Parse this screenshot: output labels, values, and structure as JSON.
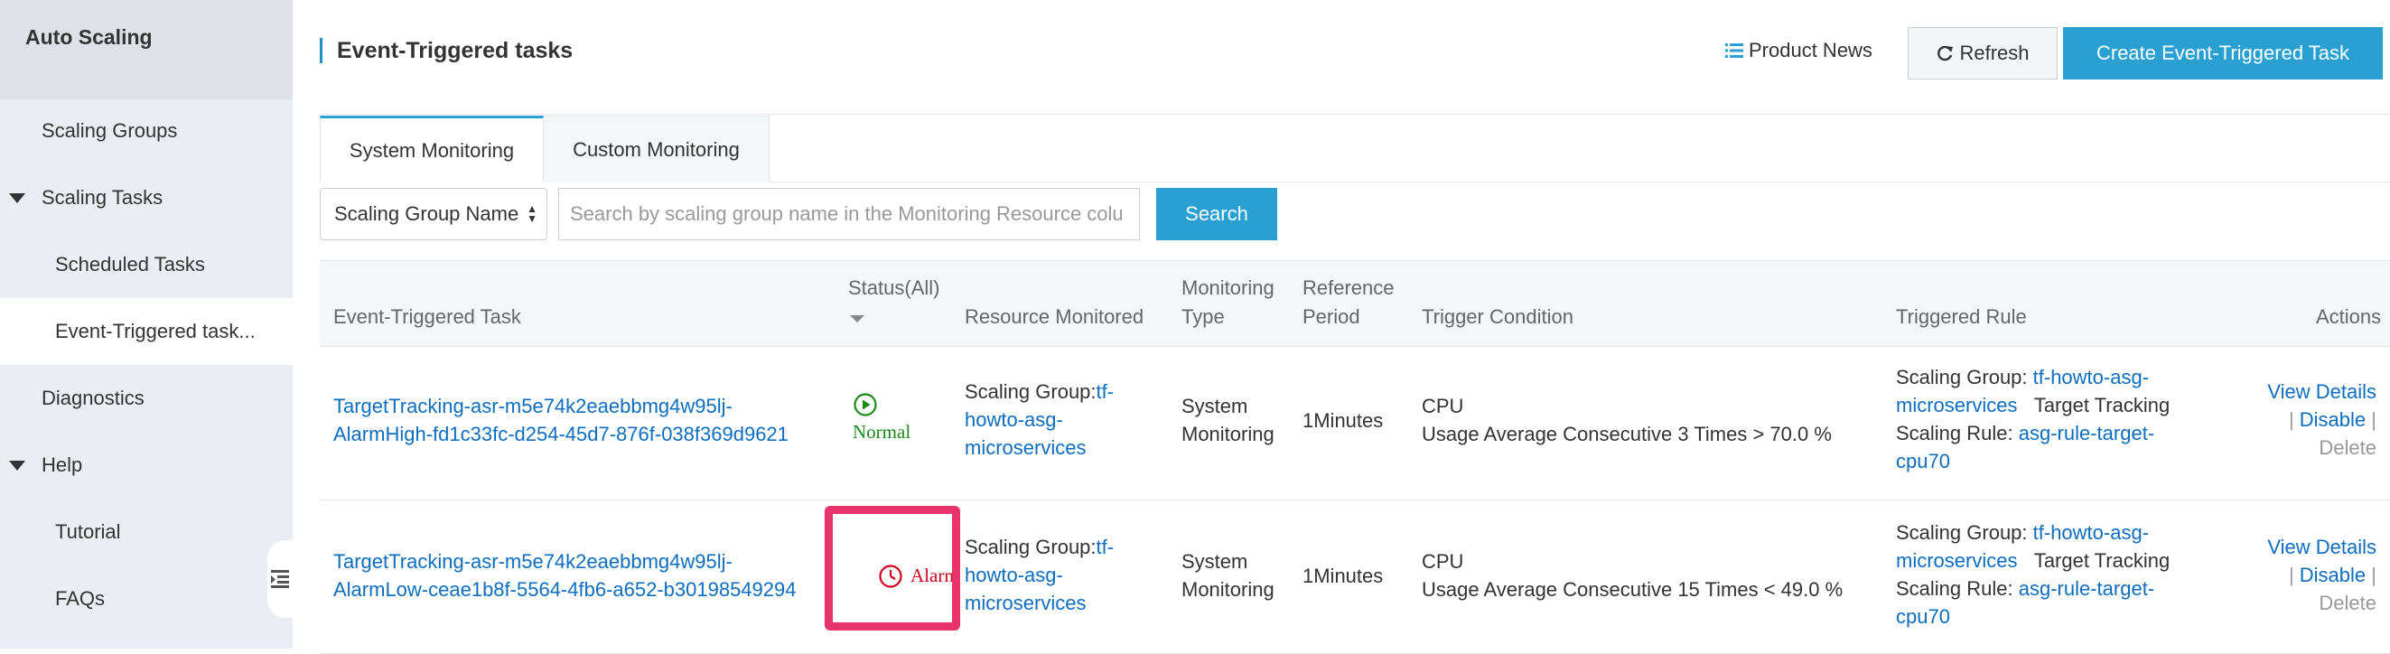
{
  "sidebar": {
    "title": "Auto Scaling",
    "items": [
      {
        "label": "Scaling Groups"
      },
      {
        "label": "Scaling Tasks"
      },
      {
        "label": "Scheduled Tasks"
      },
      {
        "label": "Event-Triggered task..."
      },
      {
        "label": "Diagnostics"
      },
      {
        "label": "Help"
      },
      {
        "label": "Tutorial"
      },
      {
        "label": "FAQs"
      }
    ]
  },
  "header": {
    "title": "Event-Triggered tasks",
    "product_news": "Product News",
    "refresh": "Refresh",
    "create": "Create Event-Triggered Task"
  },
  "tabs": [
    {
      "label": "System Monitoring"
    },
    {
      "label": "Custom Monitoring"
    }
  ],
  "filter": {
    "select_value": "Scaling Group Name",
    "placeholder": "Search by scaling group name in the Monitoring Resource colu",
    "search_button": "Search"
  },
  "table": {
    "columns": {
      "task": "Event-Triggered Task",
      "status": "Status(All)",
      "resource": "Resource Monitored",
      "type_1": "Monitoring",
      "type_2": "Type",
      "period_1": "Reference",
      "period_2": "Period",
      "condition": "Trigger Condition",
      "rule": "Triggered Rule",
      "actions": "Actions"
    },
    "rows": [
      {
        "task_line1": "TargetTracking-asr-m5e74k2eaebbmg4w95lj-",
        "task_line2": "AlarmHigh-fd1c33fc-d254-45d7-876f-038f369d9621",
        "status": "Normal",
        "resource_prefix": "Scaling Group:",
        "resource_l1": "tf-",
        "resource_l2": "howto-asg-",
        "resource_l3": "microservices",
        "type_1": "System",
        "type_2": "Monitoring",
        "period": "1Minutes",
        "condition_1": "CPU",
        "condition_2": "Usage Average Consecutive 3 Times > 70.0 %",
        "rule_group_label": "Scaling Group: ",
        "rule_group_l1": "tf-howto-asg-",
        "rule_group_l2": "microservices",
        "rule_mode": "Target Tracking",
        "rule_label": "Scaling Rule: ",
        "rule_l1": "asg-rule-target-",
        "rule_l2": "cpu70",
        "action_view": "View Details",
        "action_disable": "Disable",
        "action_delete": "Delete"
      },
      {
        "task_line1": "TargetTracking-asr-m5e74k2eaebbmg4w95lj-",
        "task_line2": "AlarmLow-ceae1b8f-5564-4fb6-a652-b30198549294",
        "status": "Alarm",
        "resource_prefix": "Scaling Group:",
        "resource_l1": "tf-",
        "resource_l2": "howto-asg-",
        "resource_l3": "microservices",
        "type_1": "System",
        "type_2": "Monitoring",
        "period": "1Minutes",
        "condition_1": "CPU",
        "condition_2": "Usage Average Consecutive 15 Times < 49.0 %",
        "rule_group_label": "Scaling Group: ",
        "rule_group_l1": "tf-howto-asg-",
        "rule_group_l2": "microservices",
        "rule_mode": "Target Tracking",
        "rule_label": "Scaling Rule: ",
        "rule_l1": "asg-rule-target-",
        "rule_l2": "cpu70",
        "action_view": "View Details",
        "action_disable": "Disable",
        "action_delete": "Delete"
      }
    ]
  },
  "colors": {
    "accent": "#2aa0d2",
    "link": "#0d6ebf",
    "normal": "#1a8a1a",
    "alarm": "#d0021b",
    "highlight": "#e8336b"
  }
}
